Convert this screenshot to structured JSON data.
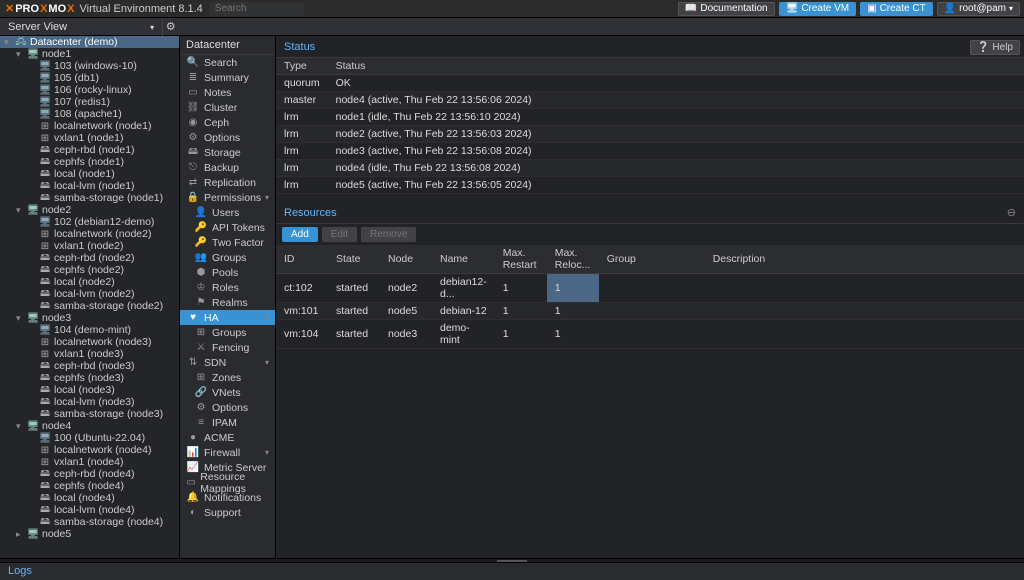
{
  "app": {
    "brand": "PROXMOX",
    "product": "Virtual Environment 8.1.4",
    "search_placeholder": "Search"
  },
  "top_buttons": {
    "doc": "Documentation",
    "create_vm": "Create VM",
    "create_ct": "Create CT",
    "user": "root@pam"
  },
  "server_view_label": "Server View",
  "tree": {
    "dc": "Datacenter (demo)",
    "nodes": [
      {
        "name": "node1",
        "children": [
          {
            "t": "vm",
            "l": "103 (windows-10)"
          },
          {
            "t": "vm",
            "l": "105 (db1)"
          },
          {
            "t": "vm",
            "l": "106 (rocky-linux)"
          },
          {
            "t": "vm",
            "l": "107 (redis1)"
          },
          {
            "t": "vm",
            "l": "108 (apache1)"
          },
          {
            "t": "net",
            "l": "localnetwork (node1)"
          },
          {
            "t": "net",
            "l": "vxlan1 (node1)"
          },
          {
            "t": "stor",
            "l": "ceph-rbd (node1)"
          },
          {
            "t": "stor",
            "l": "cephfs (node1)"
          },
          {
            "t": "stor",
            "l": "local (node1)"
          },
          {
            "t": "stor",
            "l": "local-lvm (node1)"
          },
          {
            "t": "stor",
            "l": "samba-storage (node1)"
          }
        ]
      },
      {
        "name": "node2",
        "children": [
          {
            "t": "vm",
            "l": "102 (debian12-demo)"
          },
          {
            "t": "net",
            "l": "localnetwork (node2)"
          },
          {
            "t": "net",
            "l": "vxlan1 (node2)"
          },
          {
            "t": "stor",
            "l": "ceph-rbd (node2)"
          },
          {
            "t": "stor",
            "l": "cephfs (node2)"
          },
          {
            "t": "stor",
            "l": "local (node2)"
          },
          {
            "t": "stor",
            "l": "local-lvm (node2)"
          },
          {
            "t": "stor",
            "l": "samba-storage (node2)"
          }
        ]
      },
      {
        "name": "node3",
        "children": [
          {
            "t": "vm",
            "l": "104 (demo-mint)"
          },
          {
            "t": "net",
            "l": "localnetwork (node3)"
          },
          {
            "t": "net",
            "l": "vxlan1 (node3)"
          },
          {
            "t": "stor",
            "l": "ceph-rbd (node3)"
          },
          {
            "t": "stor",
            "l": "cephfs (node3)"
          },
          {
            "t": "stor",
            "l": "local (node3)"
          },
          {
            "t": "stor",
            "l": "local-lvm (node3)"
          },
          {
            "t": "stor",
            "l": "samba-storage (node3)"
          }
        ]
      },
      {
        "name": "node4",
        "children": [
          {
            "t": "vm",
            "l": "100 (Ubuntu-22.04)"
          },
          {
            "t": "net",
            "l": "localnetwork (node4)"
          },
          {
            "t": "net",
            "l": "vxlan1 (node4)"
          },
          {
            "t": "stor",
            "l": "ceph-rbd (node4)"
          },
          {
            "t": "stor",
            "l": "cephfs (node4)"
          },
          {
            "t": "stor",
            "l": "local (node4)"
          },
          {
            "t": "stor",
            "l": "local-lvm (node4)"
          },
          {
            "t": "stor",
            "l": "samba-storage (node4)"
          }
        ]
      },
      {
        "name": "node5",
        "children": []
      }
    ]
  },
  "menu_header": "Datacenter",
  "menu": [
    {
      "l": "Search",
      "i": "🔍",
      "d": 0
    },
    {
      "l": "Summary",
      "i": "≣",
      "d": 0
    },
    {
      "l": "Notes",
      "i": "▭",
      "d": 0
    },
    {
      "l": "Cluster",
      "i": "⛓",
      "d": 0
    },
    {
      "l": "Ceph",
      "i": "◉",
      "d": 0
    },
    {
      "l": "Options",
      "i": "⚙",
      "d": 0
    },
    {
      "l": "Storage",
      "i": "🖴",
      "d": 0
    },
    {
      "l": "Backup",
      "i": "⎋",
      "d": 0
    },
    {
      "l": "Replication",
      "i": "⇄",
      "d": 0
    },
    {
      "l": "Permissions",
      "i": "🔒",
      "d": 0,
      "chev": true
    },
    {
      "l": "Users",
      "i": "👤",
      "d": 1
    },
    {
      "l": "API Tokens",
      "i": "🔑",
      "d": 1
    },
    {
      "l": "Two Factor",
      "i": "🔑",
      "d": 1
    },
    {
      "l": "Groups",
      "i": "👥",
      "d": 1
    },
    {
      "l": "Pools",
      "i": "⬢",
      "d": 1
    },
    {
      "l": "Roles",
      "i": "♔",
      "d": 1
    },
    {
      "l": "Realms",
      "i": "⚑",
      "d": 1
    },
    {
      "l": "HA",
      "i": "♥",
      "d": 0,
      "sel": true,
      "chev": true
    },
    {
      "l": "Groups",
      "i": "⊞",
      "d": 1
    },
    {
      "l": "Fencing",
      "i": "⚔",
      "d": 1
    },
    {
      "l": "SDN",
      "i": "⇅",
      "d": 0,
      "chev": true
    },
    {
      "l": "Zones",
      "i": "⊞",
      "d": 1
    },
    {
      "l": "VNets",
      "i": "🔗",
      "d": 1
    },
    {
      "l": "Options",
      "i": "⚙",
      "d": 1
    },
    {
      "l": "IPAM",
      "i": "≡",
      "d": 1
    },
    {
      "l": "ACME",
      "i": "●",
      "d": 0
    },
    {
      "l": "Firewall",
      "i": "📊",
      "d": 0,
      "chev": true
    },
    {
      "l": "Metric Server",
      "i": "📈",
      "d": 0
    },
    {
      "l": "Resource Mappings",
      "i": "▭",
      "d": 0
    },
    {
      "l": "Notifications",
      "i": "🔔",
      "d": 0
    },
    {
      "l": "Support",
      "i": "◐",
      "d": 0
    }
  ],
  "status": {
    "title": "Status",
    "headers": [
      "Type",
      "Status"
    ],
    "rows": [
      [
        "quorum",
        "OK"
      ],
      [
        "master",
        "node4 (active, Thu Feb 22 13:56:06 2024)"
      ],
      [
        "lrm",
        "node1 (idle, Thu Feb 22 13:56:10 2024)"
      ],
      [
        "lrm",
        "node2 (active, Thu Feb 22 13:56:03 2024)"
      ],
      [
        "lrm",
        "node3 (active, Thu Feb 22 13:56:08 2024)"
      ],
      [
        "lrm",
        "node4 (idle, Thu Feb 22 13:56:08 2024)"
      ],
      [
        "lrm",
        "node5 (active, Thu Feb 22 13:56:05 2024)"
      ]
    ]
  },
  "resources": {
    "title": "Resources",
    "buttons": {
      "add": "Add",
      "edit": "Edit",
      "remove": "Remove"
    },
    "headers": [
      "ID",
      "State",
      "Node",
      "Name",
      "Max. Restart",
      "Max. Reloc...",
      "Group",
      "Description"
    ],
    "rows": [
      {
        "cells": [
          "ct:102",
          "started",
          "node2",
          "debian12-d...",
          "1",
          "1",
          "",
          ""
        ],
        "sel_col": 5
      },
      {
        "cells": [
          "vm:101",
          "started",
          "node5",
          "debian-12",
          "1",
          "1",
          "",
          ""
        ]
      },
      {
        "cells": [
          "vm:104",
          "started",
          "node3",
          "demo-mint",
          "1",
          "1",
          "",
          ""
        ]
      }
    ]
  },
  "help_label": "Help",
  "logs_label": "Logs"
}
